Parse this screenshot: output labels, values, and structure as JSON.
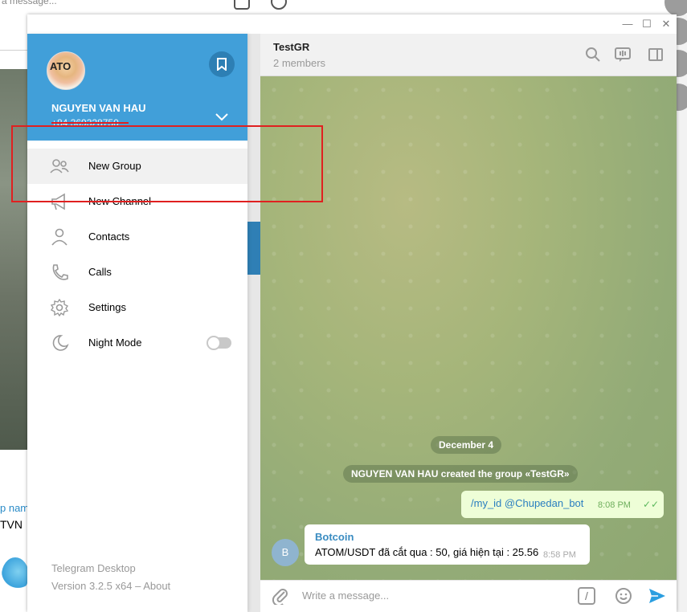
{
  "background": {
    "top_text": "a message...",
    "left_label": "p nam",
    "left_input_value": "TVN"
  },
  "window": {
    "minimize": "—",
    "maximize": "☐",
    "close": "✕"
  },
  "drawer": {
    "profile": {
      "avatar_text": "ATO",
      "name": "NGUYEN VAN HAU",
      "phone": "+84 369328750"
    },
    "menu": [
      {
        "label": "New Group",
        "icon": "users-icon"
      },
      {
        "label": "New Channel",
        "icon": "megaphone-icon"
      },
      {
        "label": "Contacts",
        "icon": "user-icon"
      },
      {
        "label": "Calls",
        "icon": "phone-icon"
      },
      {
        "label": "Settings",
        "icon": "gear-icon"
      },
      {
        "label": "Night Mode",
        "icon": "moon-icon",
        "toggle": false
      }
    ],
    "footer": {
      "title": "Telegram Desktop",
      "version": "Version 3.2.5 x64 – About"
    }
  },
  "chat": {
    "title": "TestGR",
    "subtitle": "2 members",
    "date_label": "December 4",
    "service_message": "NGUYEN VAN HAU created the group «TestGR»",
    "outgoing": {
      "text": "/my_id @Chupedan_bot",
      "time": "8:08 PM",
      "status": "read"
    },
    "incoming": {
      "avatar_letter": "B",
      "sender": "Botcoin",
      "text": "ATOM/USDT đã cắt qua : 50, giá hiện tại : 25.56",
      "time": "8:58 PM"
    },
    "composer": {
      "placeholder": "Write a message...",
      "command_symbol": "/"
    }
  },
  "colors": {
    "accent": "#419fd9",
    "annotation": "#e02020"
  }
}
